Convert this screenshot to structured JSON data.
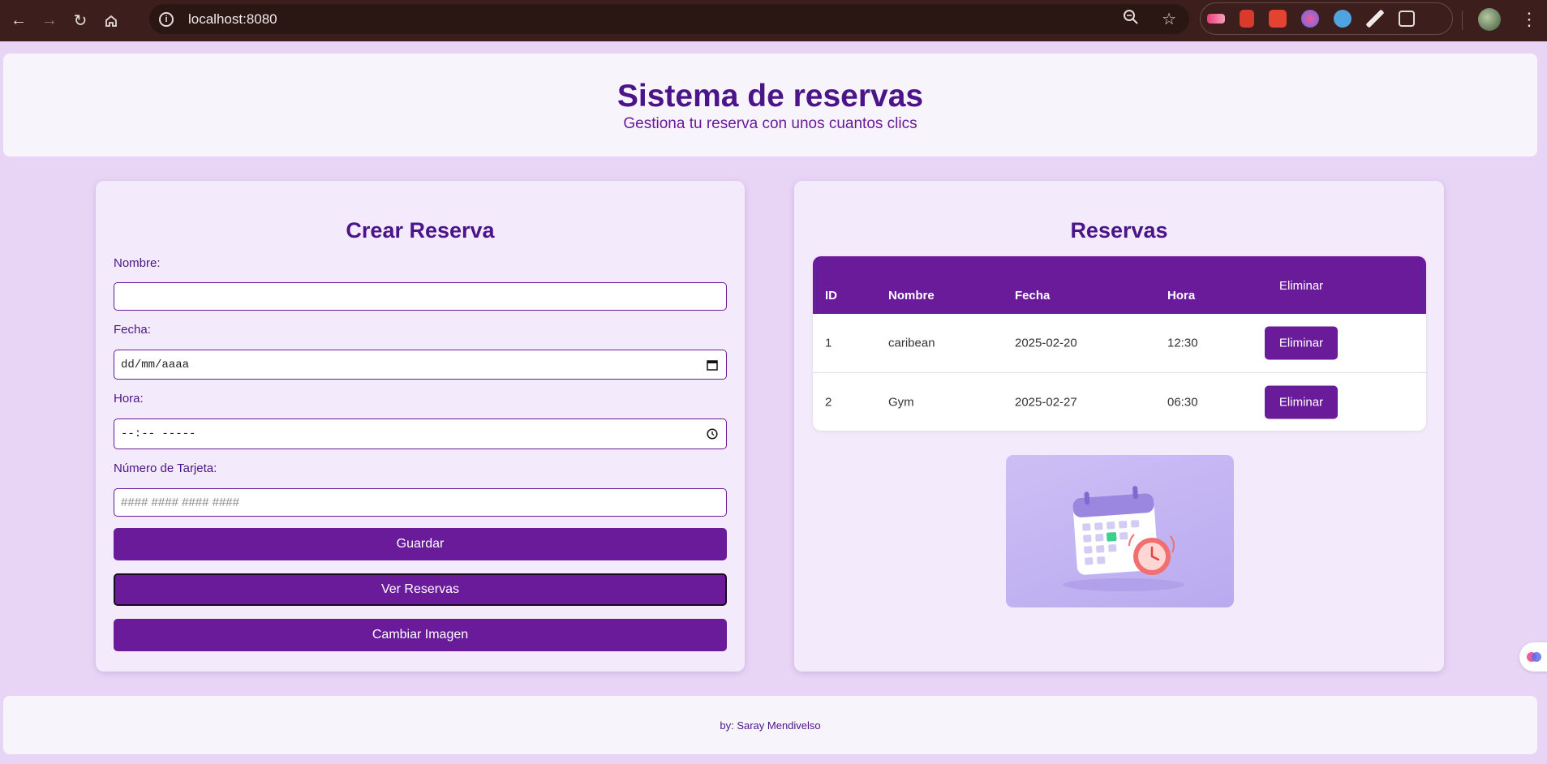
{
  "browser": {
    "url": "localhost:8080",
    "extensions": [
      "video-extension-icon",
      "book-extension-icon",
      "todoist-extension-icon",
      "brain-extension-icon",
      "robot-extension-icon",
      "eyedropper-extension-icon",
      "puzzle-extensions-icon"
    ]
  },
  "header": {
    "title": "Sistema de reservas",
    "subtitle": "Gestiona tu reserva con unos cuantos clics"
  },
  "form": {
    "title": "Crear Reserva",
    "nombre_label": "Nombre:",
    "nombre_value": "",
    "fecha_label": "Fecha:",
    "fecha_value": "dd/mm/aaaa",
    "hora_label": "Hora:",
    "hora_value": "--:-- -----",
    "tarjeta_label": "Número de Tarjeta:",
    "tarjeta_placeholder": "#### #### #### ####",
    "guardar_label": "Guardar",
    "ver_label": "Ver Reservas",
    "cambiar_label": "Cambiar Imagen"
  },
  "reservas": {
    "title": "Reservas",
    "columns": {
      "id": "ID",
      "nombre": "Nombre",
      "fecha": "Fecha",
      "hora": "Hora",
      "eliminar": "Eliminar"
    },
    "rows": [
      {
        "id": "1",
        "nombre": "caribean",
        "fecha": "2025-02-20",
        "hora": "12:30",
        "action": "Eliminar"
      },
      {
        "id": "2",
        "nombre": "Gym",
        "fecha": "2025-02-27",
        "hora": "06:30",
        "action": "Eliminar"
      }
    ]
  },
  "footer": {
    "text": "by: Saray Mendivelso"
  },
  "colors": {
    "primary": "#6a1b9a",
    "title": "#4b1488",
    "background": "#e8d5f5",
    "card": "#f3ebfb"
  }
}
